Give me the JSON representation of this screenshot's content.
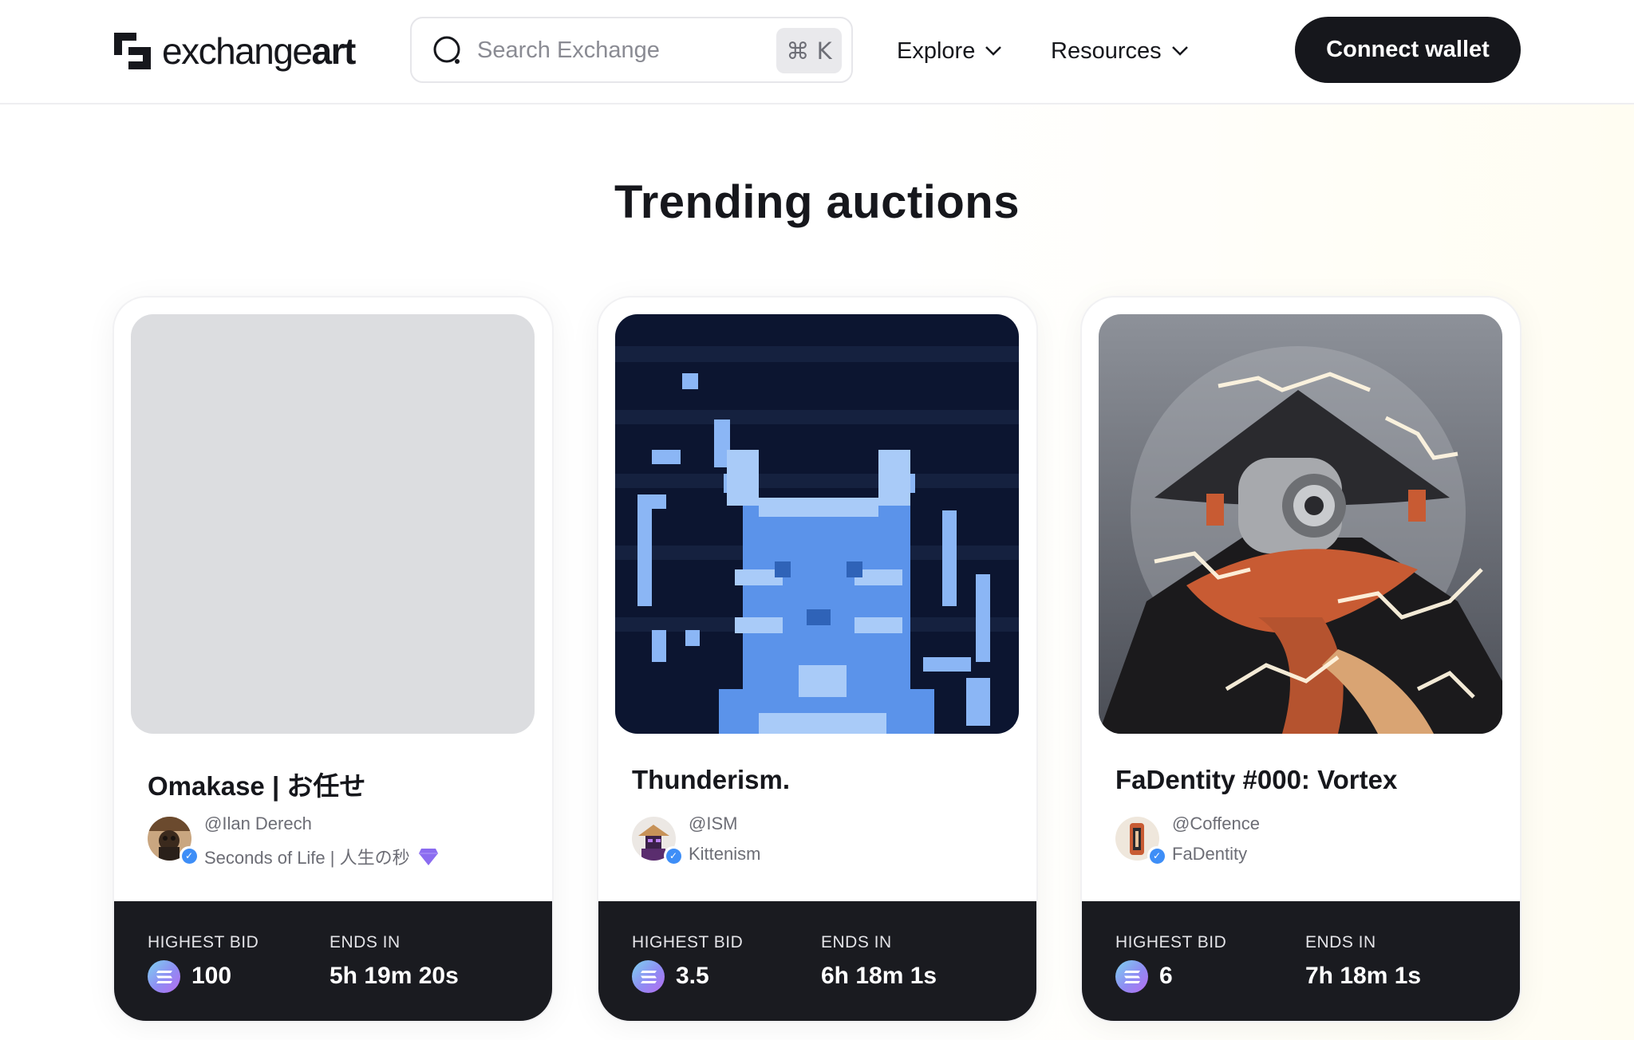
{
  "header": {
    "logo_text_regular": "exchange",
    "logo_text_bold": "art",
    "search": {
      "placeholder": "Search Exchange",
      "value": "",
      "shortcut": "⌘ K"
    },
    "nav": [
      {
        "label": "Explore",
        "icon": "chevron-down-icon"
      },
      {
        "label": "Resources",
        "icon": "chevron-down-icon"
      }
    ],
    "connect_label": "Connect wallet"
  },
  "section": {
    "title": "Trending auctions"
  },
  "cards": [
    {
      "title": "Omakase | お任せ",
      "handle": "@Ilan Derech",
      "collection": "Seconds of Life | 人生の秒",
      "collection_badge": "gem-icon",
      "verified": true,
      "highest_bid_label": "HIGHEST BID",
      "highest_bid": "100",
      "ends_in_label": "ENDS IN",
      "ends_in": "5h 19m 20s"
    },
    {
      "title": "Thunderism.",
      "handle": "@ISM",
      "collection": "Kittenism",
      "verified": true,
      "highest_bid_label": "HIGHEST BID",
      "highest_bid": "3.5",
      "ends_in_label": "ENDS IN",
      "ends_in": "6h 18m 1s"
    },
    {
      "title": "FaDentity #000: Vortex",
      "handle": "@Coffence",
      "collection": "FaDentity",
      "verified": true,
      "highest_bid_label": "HIGHEST BID",
      "highest_bid": "6",
      "ends_in_label": "ENDS IN",
      "ends_in": "7h 18m 1s"
    }
  ],
  "colors": {
    "dark": "#16171c",
    "footer": "#1a1b20",
    "verified_blue": "#3e8ef7",
    "gem_purple": "#8b6cf0"
  }
}
